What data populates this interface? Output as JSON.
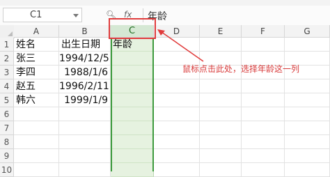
{
  "formula_bar": {
    "cell_ref": "C1",
    "content": "年龄"
  },
  "columns": [
    "A",
    "B",
    "C",
    "D",
    "E",
    "F",
    "G"
  ],
  "rows": [
    "1",
    "2",
    "3",
    "4",
    "5",
    "6",
    "7",
    "8",
    "9",
    "10"
  ],
  "cells": {
    "A1": "姓名",
    "B1": "出生日期",
    "C1": "年龄",
    "A2": "张三",
    "B2": "1994/12/5",
    "A3": "李四",
    "B3": "1988/1/6",
    "A4": "赵五",
    "B4": "1996/2/11",
    "A5": "韩六",
    "B5": "1999/1/9"
  },
  "annotation": {
    "text": "鼠标点击此处，选择年龄这一列"
  },
  "colors": {
    "selection": "#3c9a3c",
    "highlight": "#e03c3c"
  }
}
